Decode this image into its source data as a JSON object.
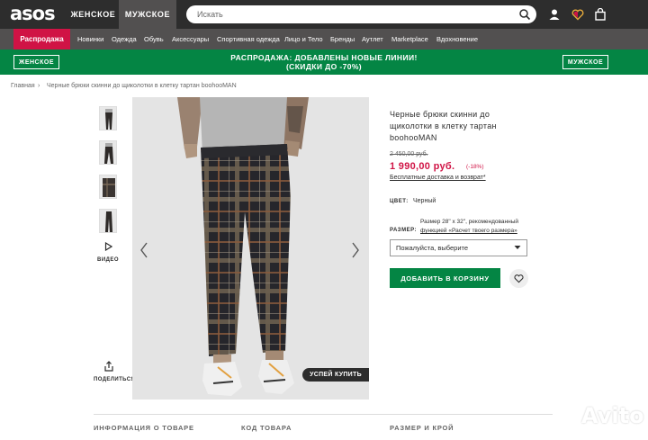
{
  "header": {
    "logo": "asos",
    "tab_women": "ЖЕНСКОЕ",
    "tab_men": "МУЖСКОЕ",
    "search_placeholder": "Искать"
  },
  "nav": {
    "sale": "Распродажа",
    "items": [
      "Новинки",
      "Одежда",
      "Обувь",
      "Аксессуары",
      "Спортивная одежда",
      "Лицо и Тело",
      "Бренды",
      "Аутлет",
      "Marketplace",
      "Вдохновение"
    ]
  },
  "promo": {
    "women_btn": "ЖЕНСКОЕ",
    "men_btn": "МУЖСКОЕ",
    "line1": "РАСПРОДАЖА: ДОБАВЛЕНЫ НОВЫЕ ЛИНИИ!",
    "line2": "(СКИДКИ ДО -70%)"
  },
  "breadcrumb": {
    "home": "Главная",
    "separator": "›",
    "current": "Черные брюки скинни до щиколотки в клетку тартан boohooMAN"
  },
  "gallery": {
    "video_label": "ВИДЕО",
    "share_label": "ПОДЕЛИТЬСЯ",
    "badge": "УСПЕЙ КУПИТЬ"
  },
  "product": {
    "title": "Черные брюки скинни до щиколотки в клетку тартан boohooMAN",
    "old_price": "2 450,00 руб.",
    "price": "1 990,00 руб.",
    "discount": "(-18%)",
    "delivery": "Бесплатные доставка и возврат*",
    "color_label": "ЦВЕТ:",
    "color_value": "Черный",
    "size_label": "РАЗМЕР:",
    "size_help_1": "Размер 28\" x 32\", рекомендованный",
    "size_help_2": "функцией «Расчет твоего размера»",
    "size_select": "Пожалуйста, выберите",
    "add_to_cart": "ДОБАВИТЬ В КОРЗИНУ"
  },
  "footer": {
    "col1": "ИНФОРМАЦИЯ О ТОВАРЕ",
    "col2": "КОД ТОВАРА",
    "col3": "РАЗМЕР И КРОЙ"
  },
  "watermark": "Avito",
  "colors": {
    "header_bg": "#2d2d2d",
    "nav_bg": "#525050",
    "sale_red": "#d01345",
    "promo_green": "#048544",
    "price_red": "#d01345"
  }
}
